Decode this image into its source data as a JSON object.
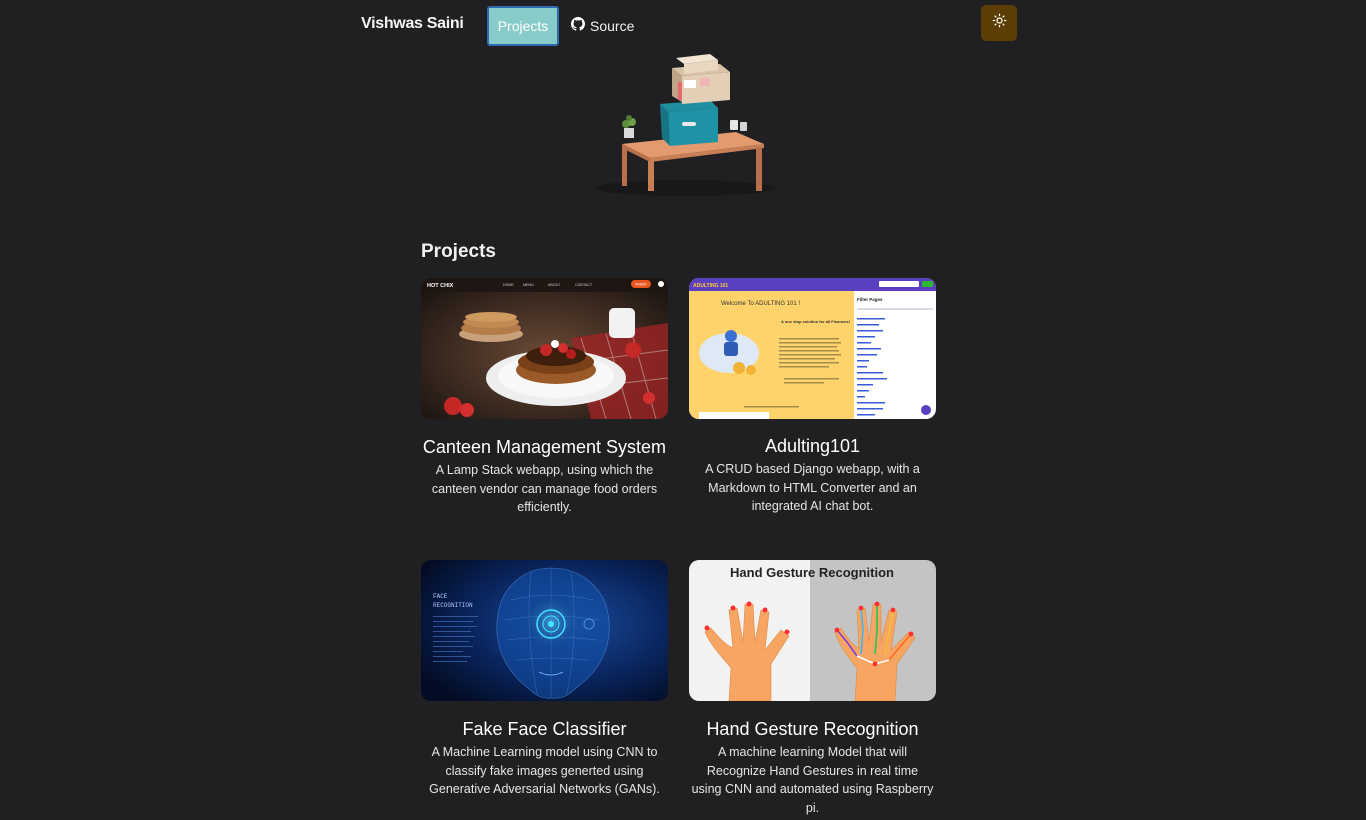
{
  "nav": {
    "brand": "Vishwas Saini",
    "projects_label": "Projects",
    "source_label": "Source",
    "source_icon": "github-icon",
    "theme_icon": "sun-icon"
  },
  "colors": {
    "background": "#202023",
    "projects_button": "#88ccca",
    "theme_button": "#5c3e04"
  },
  "section": {
    "title": "Projects"
  },
  "projects": [
    {
      "title": "Canteen Management System",
      "description": "A Lamp Stack webapp, using which the canteen vendor can manage food orders efficiently.",
      "thumbnail": "Food website screenshot",
      "thumb_logo": "HOT CHIX",
      "thumb_nav": [
        "HOME",
        "MENU",
        "ABOUT",
        "CONTACT"
      ],
      "thumb_cta": "ORDER"
    },
    {
      "title": "Adulting101",
      "description": "A CRUD based Django webapp, with a Markdown to HTML Converter and an integrated AI chat bot.",
      "thumbnail": "Adulting 101 website screenshot",
      "thumb_logo": "ADULTING 101",
      "thumb_welcome": "Welcome To ADULTING 101 !",
      "thumb_tagline": "A one stop solution for all Finances!",
      "thumb_filter": "Filter Pages"
    },
    {
      "title": "Fake Face Classifier",
      "description": "A Machine Learning model using CNN to classify fake images generted using Generative Adversarial Networks (GANs).",
      "thumbnail": "Face recognition graphic",
      "thumb_label": "FACE\nRECOGNITION"
    },
    {
      "title": "Hand Gesture Recognition",
      "description": "A machine learning Model that will Recognize Hand Gestures in real time using CNN and automated using Raspberry pi.",
      "thumbnail": "Hand gesture recognition graphic",
      "thumb_label": "Hand Gesture Recognition"
    }
  ]
}
